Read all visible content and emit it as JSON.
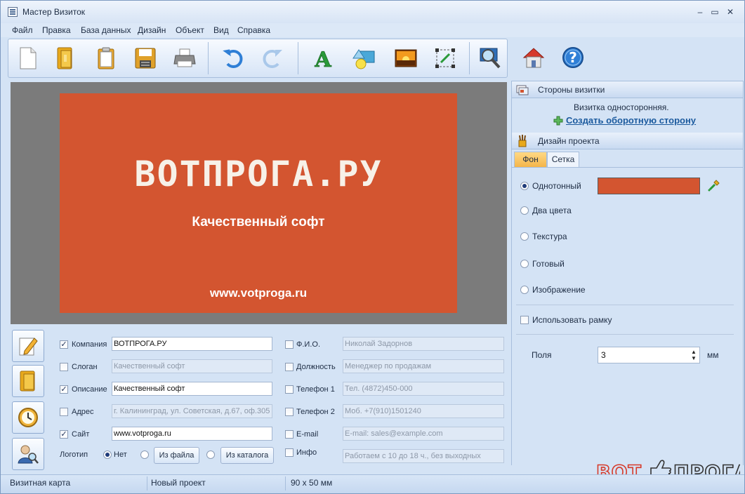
{
  "window": {
    "title": "Мастер Визиток",
    "controls": {
      "minimize": "–",
      "maximize": "▭",
      "close": "✕"
    }
  },
  "menu": [
    "Файл",
    "Правка",
    "База данных",
    "Дизайн",
    "Объект",
    "Вид",
    "Справка"
  ],
  "toolbar": {
    "buttons": [
      "new-document-icon",
      "open-folder-icon",
      "clipboard-icon",
      "save-disk-icon",
      "printer-icon",
      "undo-icon",
      "redo-icon",
      "text-a-icon",
      "shapes-icon",
      "image-icon",
      "resize-icon",
      "zoom-icon",
      "home-icon",
      "help-icon"
    ]
  },
  "card": {
    "background": "#d35530",
    "company": "ВОТПРОГА.РУ",
    "description": "Качественный софт",
    "site": "www.votproga.ru"
  },
  "fields": {
    "left": [
      {
        "label": "Компания",
        "checked": true,
        "value": "ВОТПРОГА.РУ"
      },
      {
        "label": "Слоган",
        "checked": false,
        "value": "Качественный софт"
      },
      {
        "label": "Описание",
        "checked": true,
        "value": "Качественный софт"
      },
      {
        "label": "Адрес",
        "checked": false,
        "value": "г. Калининград, ул. Советская, д.67, оф.305"
      },
      {
        "label": "Сайт",
        "checked": true,
        "value": "www.votproga.ru"
      }
    ],
    "right": [
      {
        "label": "Ф.И.О.",
        "checked": false,
        "value": "Николай Задорнов"
      },
      {
        "label": "Должность",
        "checked": false,
        "value": "Менеджер по продажам"
      },
      {
        "label": "Телефон 1",
        "checked": false,
        "value": "Тел. (4872)450-000"
      },
      {
        "label": "Телефон 2",
        "checked": false,
        "value": "Моб. +7(910)1501240"
      },
      {
        "label": "E-mail",
        "checked": false,
        "value": "E-mail: sales@example.com"
      },
      {
        "label": "Инфо",
        "checked": false,
        "value": "Работаем с 10 до 18 ч., без выходных"
      }
    ],
    "logo": {
      "label": "Логотип",
      "none_label": "Нет",
      "from_file_label": "Из файла",
      "from_catalog_label": "Из каталога"
    },
    "check_mark": "✓"
  },
  "right_panel": {
    "sides": {
      "title": "Стороны визитки",
      "info": "Визитка односторонняя.",
      "create_back_link": "Создать оборотную сторону"
    },
    "design": {
      "title": "Дизайн проекта",
      "tabs": [
        "Фон",
        "Сетка"
      ],
      "active_tab": "Фон",
      "fill_options": [
        "Однотонный",
        "Два цвета",
        "Текстура",
        "Готовый",
        "Изображение"
      ],
      "selected_fill": "Однотонный",
      "fill_color": "#d35530",
      "use_frame_label": "Использовать рамку",
      "margin_label": "Поля",
      "margin_value": "3",
      "margin_unit": "мм"
    }
  },
  "status": {
    "mode": "Визитная карта",
    "project": "Новый проект",
    "size": "90 x 50 мм"
  },
  "watermark": {
    "text": "ВОТ ПРОГА"
  }
}
